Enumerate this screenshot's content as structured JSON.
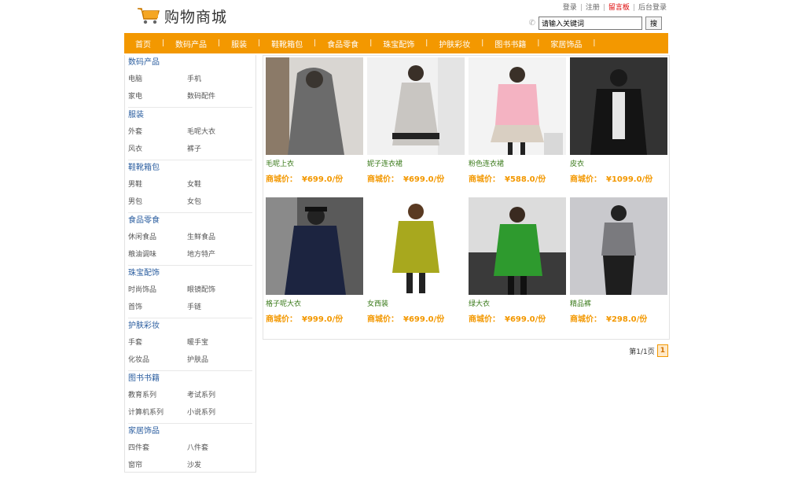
{
  "header": {
    "site_title": "购物商城",
    "top_links": [
      "登录",
      "注册",
      "留言板",
      "后台登录"
    ],
    "search_value": "请输入关键词",
    "search_button": "搜"
  },
  "nav": [
    "首页",
    "数码产品",
    "服装",
    "鞋靴箱包",
    "食品零食",
    "珠宝配饰",
    "护肤彩妆",
    "图书书籍",
    "家居饰品"
  ],
  "sidebar": [
    {
      "title": "数码产品",
      "items": [
        "电脑",
        "手机",
        "家电",
        "数码配件"
      ]
    },
    {
      "title": "服装",
      "items": [
        "外套",
        "毛呢大衣",
        "风衣",
        "裤子"
      ]
    },
    {
      "title": "鞋靴箱包",
      "items": [
        "男鞋",
        "女鞋",
        "男包",
        "女包"
      ]
    },
    {
      "title": "食品零食",
      "items": [
        "休闲食品",
        "生鲜食品",
        "粮油调味",
        "地方特产"
      ]
    },
    {
      "title": "珠宝配饰",
      "items": [
        "时尚饰品",
        "眼镜配饰",
        "首饰",
        "手链"
      ]
    },
    {
      "title": "护肤彩妆",
      "items": [
        "手套",
        "暖手宝",
        "化妆品",
        "护肤品"
      ]
    },
    {
      "title": "图书书籍",
      "items": [
        "教育系列",
        "考试系列",
        "计算机系列",
        "小说系列"
      ]
    },
    {
      "title": "家居饰品",
      "items": [
        "四件套",
        "八件套",
        "窗帘",
        "沙发"
      ]
    }
  ],
  "price_label": "商城价：",
  "products": [
    {
      "name": "毛呢上衣",
      "price": "¥699.0/份"
    },
    {
      "name": "妮子连衣裙",
      "price": "¥699.0/份"
    },
    {
      "name": "粉色连衣裙",
      "price": "¥588.0/份"
    },
    {
      "name": "皮衣",
      "price": "¥1099.0/份"
    },
    {
      "name": "格子呢大衣",
      "price": "¥999.0/份"
    },
    {
      "name": "女西装",
      "price": "¥699.0/份"
    },
    {
      "name": "绿大衣",
      "price": "¥699.0/份"
    },
    {
      "name": "精品裤",
      "price": "¥298.0/份"
    }
  ],
  "pager": {
    "text": "第1/1页",
    "current": "1"
  },
  "colors": {
    "accent": "#f39800",
    "category_title": "#2a5d9f",
    "product_name": "#3a7a1a"
  }
}
